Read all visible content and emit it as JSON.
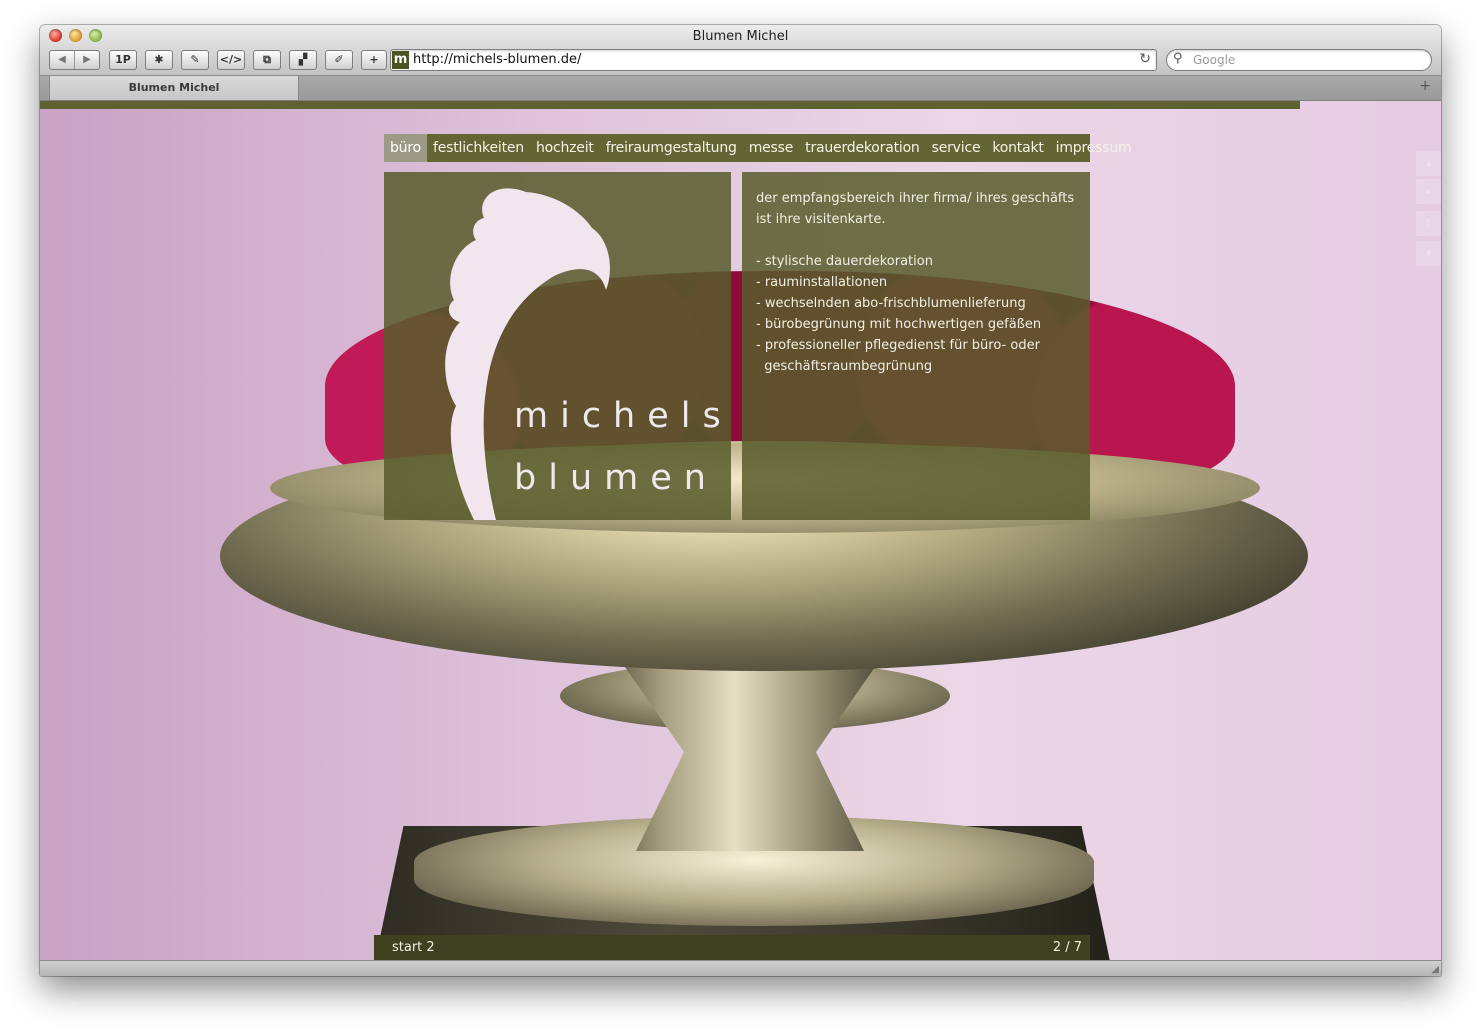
{
  "window": {
    "title": "Blumen Michel"
  },
  "toolbar": {
    "back_icon": "back-arrow-icon",
    "forward_icon": "forward-arrow-icon",
    "onepassword_label": "1P",
    "add_bookmark_label": "+",
    "address": "http://michels-blumen.de/",
    "site_icon_letter": "m",
    "search_placeholder": "Google"
  },
  "tabs": [
    {
      "label": "Blumen Michel"
    }
  ],
  "nav": {
    "items": [
      {
        "label": "büro",
        "active": true
      },
      {
        "label": "festlichkeiten"
      },
      {
        "label": "hochzeit"
      },
      {
        "label": "freiraumgestaltung"
      },
      {
        "label": "messe"
      },
      {
        "label": "trauerdekoration"
      },
      {
        "label": "service"
      },
      {
        "label": "kontakt"
      },
      {
        "label": "impressum"
      }
    ]
  },
  "logo": {
    "line1": "michels",
    "line2": "blumen"
  },
  "content": {
    "intro": "der empfangsbereich ihrer firma/ ihres geschäfts ist ihre visitenkarte.",
    "bullets": [
      "- stylische  dauerdekoration",
      "- rauminstallationen",
      "- wechselnden abo-frischblumenlieferung",
      "- bürobegrünung mit hochwertigen gefäßen",
      "- professioneller pflegedienst für büro- oder",
      "  geschäftsraumbegrünung"
    ]
  },
  "slideshow": {
    "caption": "start 2",
    "counter": "2 / 7"
  },
  "colors": {
    "brand_olive": "#636634",
    "panel_olive": "#585c2c",
    "active_tab": "#9b9a86",
    "footer_bar": "#3e4120"
  }
}
